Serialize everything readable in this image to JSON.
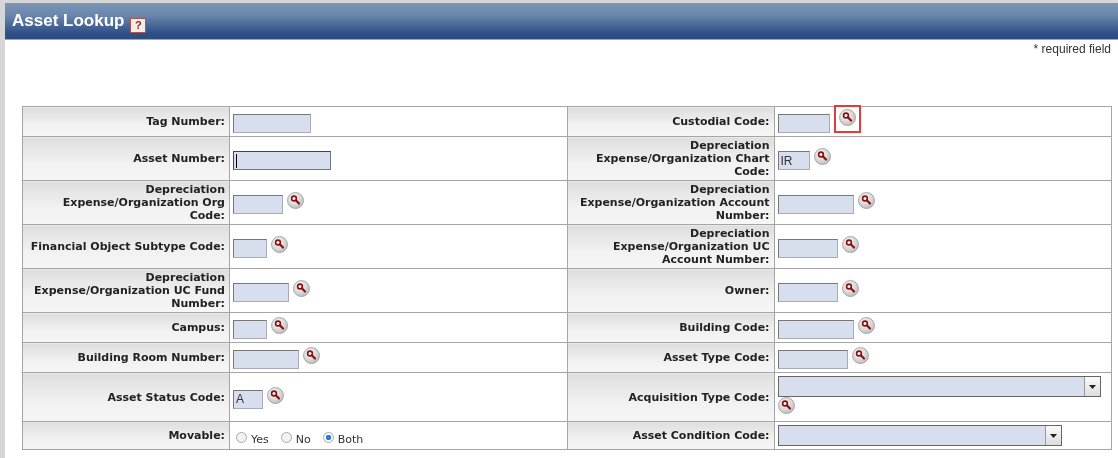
{
  "header": {
    "title": "Asset Lookup",
    "help": "?"
  },
  "required_note": "* required field",
  "rows": [
    {
      "left": {
        "label": "Tag Number:",
        "field": {
          "kind": "text",
          "lookup": false,
          "focused": false
        }
      },
      "right": {
        "label": "Custodial Code:",
        "field": {
          "kind": "text",
          "lookup": true,
          "highlighted": true,
          "focused": false
        }
      }
    },
    {
      "left": {
        "label": "Asset Number:",
        "field": {
          "kind": "text",
          "lookup": false,
          "focused": true
        }
      },
      "right": {
        "label": "Depreciation Expense/Organization Chart Code:",
        "field": {
          "kind": "text",
          "value": "IR",
          "lookup": true,
          "focused": false
        }
      }
    },
    {
      "left": {
        "label": "Depreciation Expense/Organization Org Code:",
        "field": {
          "kind": "text",
          "lookup": true,
          "focused": false
        }
      },
      "right": {
        "label": "Depreciation Expense/Organization Account Number:",
        "field": {
          "kind": "text",
          "lookup": true,
          "focused": false
        }
      }
    },
    {
      "left": {
        "label": "Financial Object Subtype Code:",
        "field": {
          "kind": "text",
          "lookup": true,
          "focused": false
        }
      },
      "right": {
        "label": "Depreciation Expense/Organization UC Account Number:",
        "field": {
          "kind": "text",
          "lookup": true,
          "focused": false
        }
      }
    },
    {
      "left": {
        "label": "Depreciation Expense/Organization UC Fund Number:",
        "field": {
          "kind": "text",
          "lookup": true,
          "focused": false
        }
      },
      "right": {
        "label": "Owner:",
        "field": {
          "kind": "text",
          "lookup": true,
          "focused": false
        }
      }
    },
    {
      "left": {
        "label": "Campus:",
        "field": {
          "kind": "text",
          "lookup": true,
          "focused": false
        }
      },
      "right": {
        "label": "Building Code:",
        "field": {
          "kind": "text",
          "lookup": true,
          "focused": false
        }
      }
    },
    {
      "left": {
        "label": "Building Room Number:",
        "field": {
          "kind": "text",
          "lookup": true,
          "focused": false
        }
      },
      "right": {
        "label": "Asset Type Code:",
        "field": {
          "kind": "text",
          "lookup": true,
          "focused": false
        }
      }
    },
    {
      "left": {
        "label": "Asset Status Code:",
        "field": {
          "kind": "text",
          "value": "A",
          "lookup": true,
          "focused": false
        }
      },
      "right": {
        "label": "Acquisition Type Code:",
        "field": {
          "kind": "select",
          "lookup": true
        }
      }
    },
    {
      "left": {
        "label": "Movable:",
        "field": {
          "kind": "radio",
          "options": [
            {
              "label": "Yes",
              "selected": false
            },
            {
              "label": "No",
              "selected": false
            },
            {
              "label": "Both",
              "selected": true
            }
          ]
        }
      },
      "right": {
        "label": "Asset Condition Code:",
        "field": {
          "kind": "select",
          "lookup": false
        }
      }
    }
  ]
}
